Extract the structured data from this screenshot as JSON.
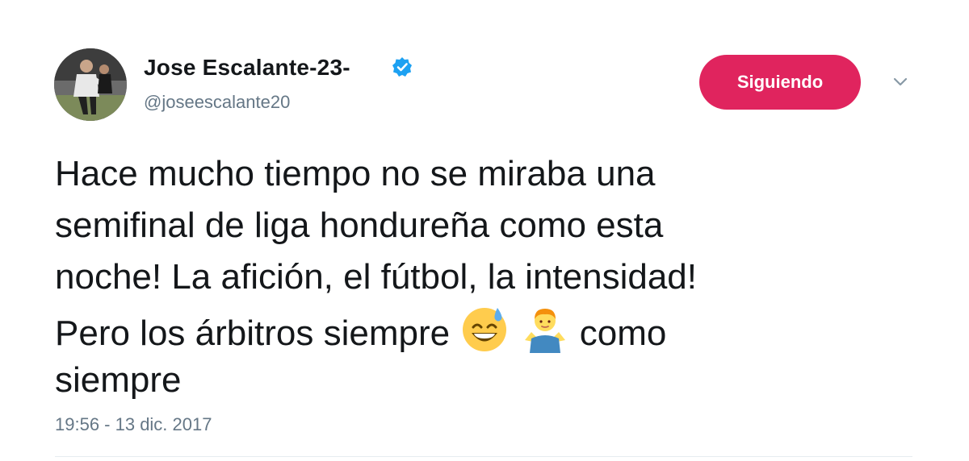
{
  "user": {
    "display_name": "Jose Escalante-23-",
    "handle": "@joseescalante20",
    "verified": true,
    "avatar_icon": "profile-photo-avatar"
  },
  "actions": {
    "follow_label": "Siguiendo",
    "follow_color": "#e0245e",
    "more_icon": "chevron-down-icon"
  },
  "tweet": {
    "lines": [
      "Hace mucho tiempo no se miraba una",
      "semifinal de liga hondureña como esta",
      "noche! La afición, el fútbol, la intensidad!",
      "Pero los árbitros siempre",
      "como",
      "siempre"
    ],
    "emojis": [
      "grinning-face-with-sweat-emoji",
      "man-shrugging-emoji"
    ],
    "timestamp": "19:56 - 13 dic. 2017"
  },
  "colors": {
    "text": "#14171a",
    "muted": "#657786",
    "verified": "#1da1f2"
  }
}
